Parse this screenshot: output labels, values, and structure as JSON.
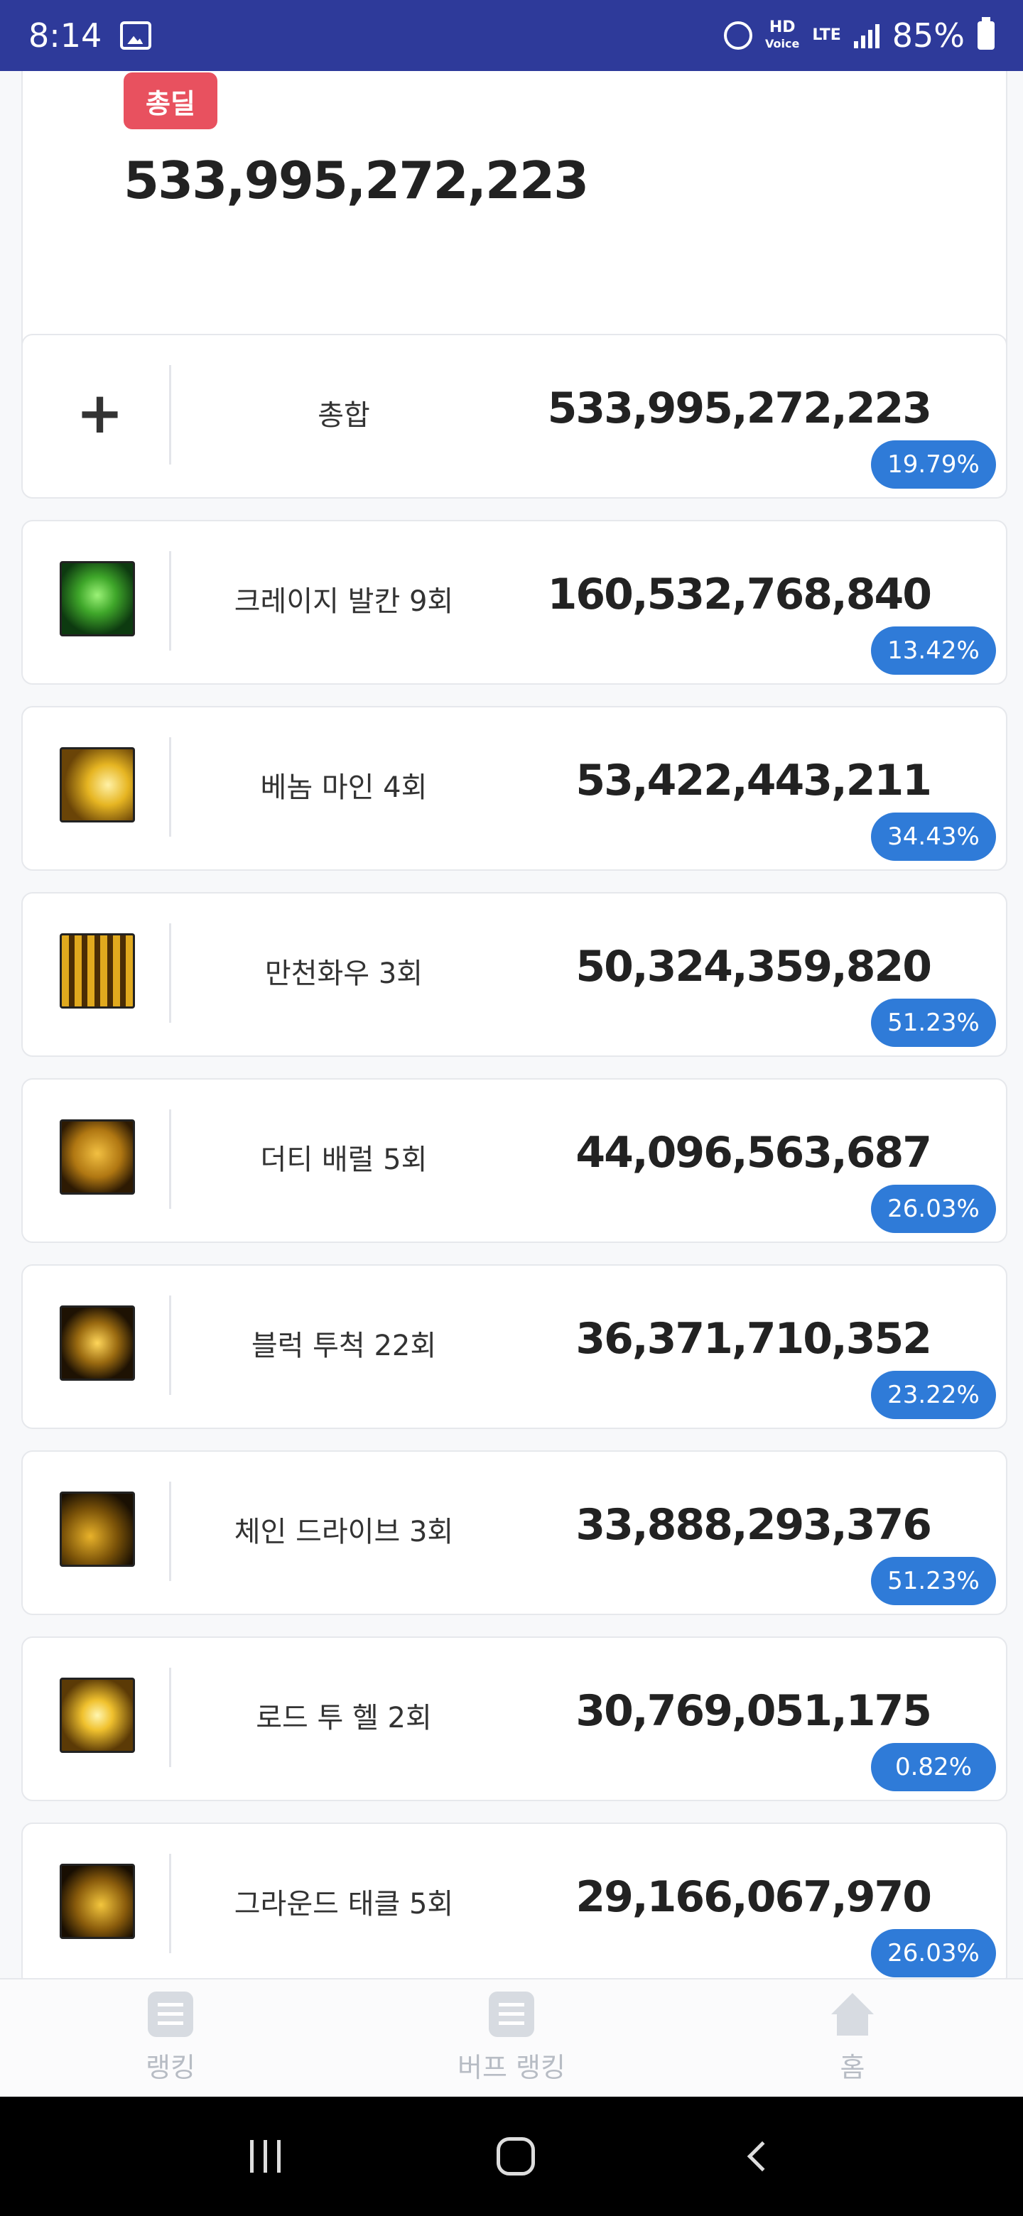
{
  "status_bar": {
    "time": "8:14",
    "hd_top": "HD",
    "hd_bottom": "Voice",
    "lte": "LTE",
    "battery": "85%"
  },
  "summary": {
    "badge": "총딜",
    "total": "533,995,272,223"
  },
  "rows": [
    {
      "name": "총합",
      "value": "533,995,272,223",
      "percent": "19.79%",
      "icon": "plus-icon"
    },
    {
      "name": "크레이지 발칸 9회",
      "value": "160,532,768,840",
      "percent": "13.42%",
      "icon": "crazy-vulcan-skill-icon"
    },
    {
      "name": "베놈 마인 4회",
      "value": "53,422,443,211",
      "percent": "34.43%",
      "icon": "venom-mine-skill-icon"
    },
    {
      "name": "만천화우 3회",
      "value": "50,324,359,820",
      "percent": "51.23%",
      "icon": "mancheon-hwau-skill-icon"
    },
    {
      "name": "더티 배럴 5회",
      "value": "44,096,563,687",
      "percent": "26.03%",
      "icon": "dirty-barrel-skill-icon"
    },
    {
      "name": "블럭 투척 22회",
      "value": "36,371,710,352",
      "percent": "23.22%",
      "icon": "block-throw-skill-icon"
    },
    {
      "name": "체인 드라이브 3회",
      "value": "33,888,293,376",
      "percent": "51.23%",
      "icon": "chain-drive-skill-icon"
    },
    {
      "name": "로드 투 헬 2회",
      "value": "30,769,051,175",
      "percent": "0.82%",
      "icon": "road-to-hell-skill-icon"
    },
    {
      "name": "그라운드 태클 5회",
      "value": "29,166,067,970",
      "percent": "26.03%",
      "icon": "ground-tackle-skill-icon"
    }
  ],
  "bottom_nav": [
    {
      "label": "랭킹",
      "icon": "list-icon"
    },
    {
      "label": "버프 랭킹",
      "icon": "list-icon"
    },
    {
      "label": "홈",
      "icon": "home-icon"
    }
  ],
  "colors": {
    "status_bar": "#2e3a9a",
    "badge_red": "#e8515f",
    "percent_pill": "#2f7bd8"
  }
}
